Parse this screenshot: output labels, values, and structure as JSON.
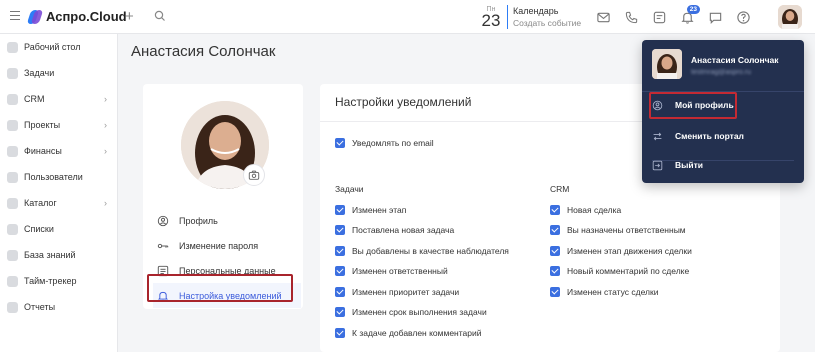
{
  "app": {
    "brand": "Аспро.Cloud"
  },
  "calendar": {
    "weekday": "Пн",
    "day": "23",
    "label": "Календарь",
    "action": "Создать событие"
  },
  "notifications": {
    "badge": "23"
  },
  "sidebar": {
    "items": [
      {
        "label": "Рабочий стол",
        "icon": "desktop-icon",
        "chevron": false
      },
      {
        "label": "Задачи",
        "icon": "tasks-icon",
        "chevron": false
      },
      {
        "label": "CRM",
        "icon": "crm-icon",
        "chevron": true
      },
      {
        "label": "Проекты",
        "icon": "projects-icon",
        "chevron": true
      },
      {
        "label": "Финансы",
        "icon": "finance-icon",
        "chevron": true
      },
      {
        "label": "Пользователи",
        "icon": "users-icon",
        "chevron": false
      },
      {
        "label": "Каталог",
        "icon": "catalog-icon",
        "chevron": true
      },
      {
        "label": "Списки",
        "icon": "lists-icon",
        "chevron": false
      },
      {
        "label": "База знаний",
        "icon": "knowledge-icon",
        "chevron": false
      },
      {
        "label": "Тайм-трекер",
        "icon": "timer-icon",
        "chevron": false
      },
      {
        "label": "Отчеты",
        "icon": "reports-icon",
        "chevron": false
      }
    ],
    "chevron": "›"
  },
  "page": {
    "title": "Анастасия Солончак"
  },
  "profile_menu": {
    "items": [
      {
        "label": "Профиль",
        "icon": "user-circle-icon"
      },
      {
        "label": "Изменение пароля",
        "icon": "key-icon"
      },
      {
        "label": "Персональные данные",
        "icon": "id-card-icon"
      },
      {
        "label": "Настройка уведомлений",
        "icon": "bell-icon",
        "active": true
      }
    ]
  },
  "settings": {
    "title": "Настройки уведомлений",
    "email_toggle": "Уведомлять по email",
    "tasks_header": "Задачи",
    "crm_header": "CRM",
    "tasks": [
      "Изменен этап",
      "Поставлена новая задача",
      "Вы добавлены в качестве наблюдателя",
      "Изменен ответственный",
      "Изменен приоритет задачи",
      "Изменен срок выполнения задачи",
      "К задаче добавлен комментарий"
    ],
    "crm": [
      "Новая сделка",
      "Вы назначены ответственным",
      "Изменен этап движения сделки",
      "Новый комментарий по сделке",
      "Изменен статус сделки"
    ]
  },
  "user_dropdown": {
    "name": "Анастасия Солончак",
    "email": "testmrag@aspro.ru",
    "items": [
      {
        "label": "Мой профиль",
        "icon": "user-circle-icon"
      },
      {
        "label": "Сменить портал",
        "icon": "swap-icon"
      },
      {
        "label": "Выйти",
        "icon": "logout-icon"
      }
    ]
  },
  "colors": {
    "accent": "#3b6fe0",
    "highlight": "#a8242c",
    "dropdown_bg": "#23304f"
  }
}
